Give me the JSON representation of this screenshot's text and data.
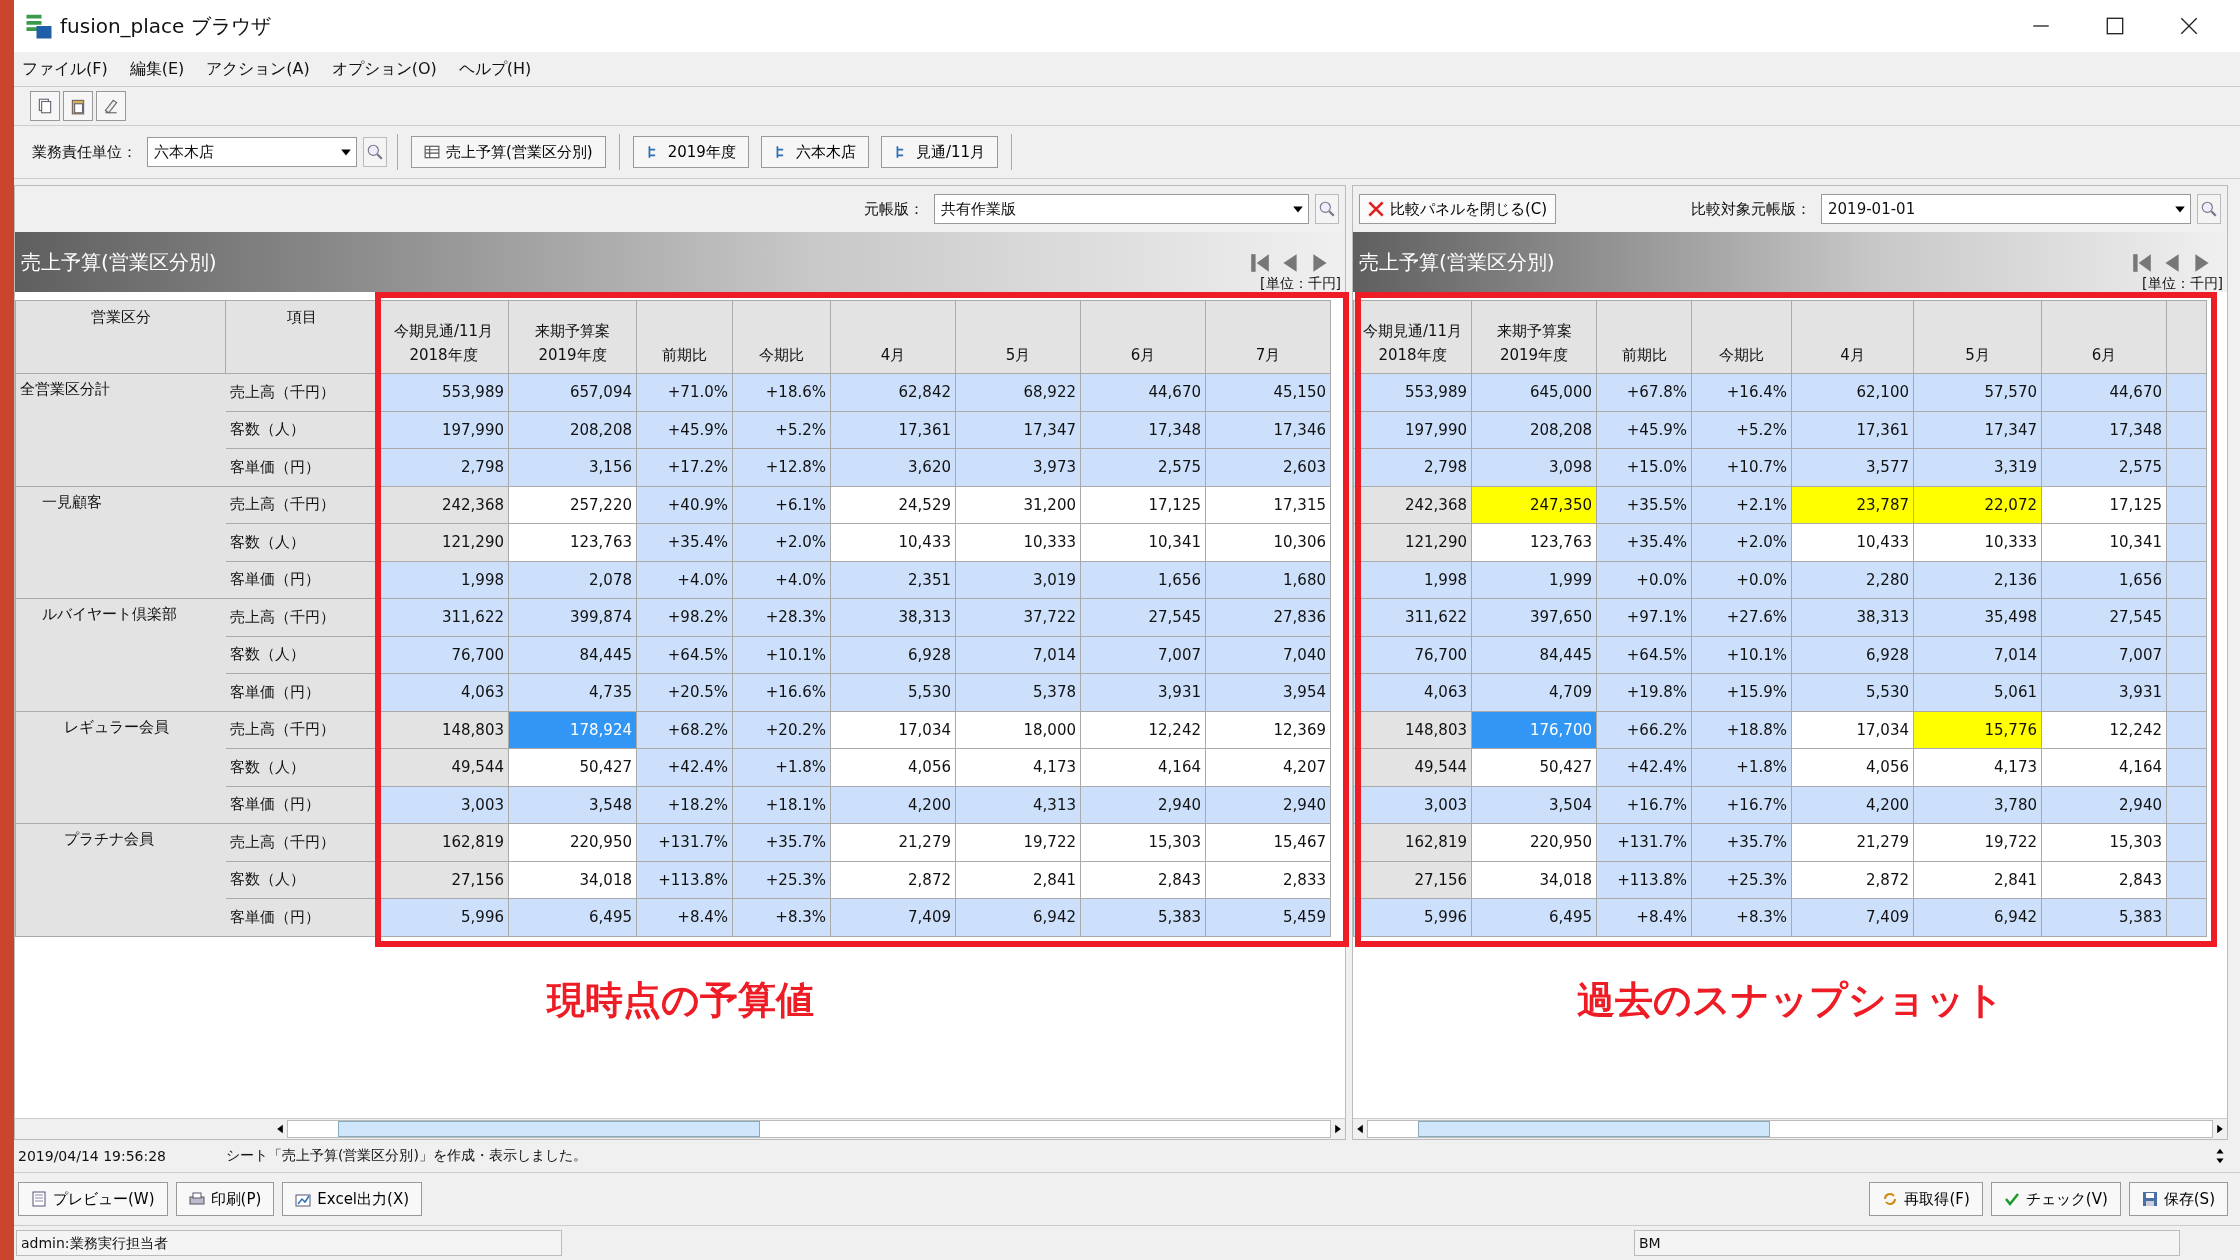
{
  "window": {
    "title": "fusion_place ブラウザ"
  },
  "menu": [
    "ファイル(F)",
    "編集(E)",
    "アクション(A)",
    "オプション(O)",
    "ヘルプ(H)"
  ],
  "toolbar": {
    "unit_label": "業務責任単位：",
    "unit_value": "六本木店",
    "chips": [
      {
        "label": "売上予算(営業区分別)",
        "kind": "sheet"
      },
      {
        "label": "2019年度",
        "kind": "dimension"
      },
      {
        "label": "六本木店",
        "kind": "dimension"
      },
      {
        "label": "見通/11月",
        "kind": "dimension"
      }
    ]
  },
  "left_panel": {
    "ledger_label": "元帳版：",
    "ledger_value": "共有作業版",
    "title": "売上予算(営業区分別)",
    "unit": "[単位：千円]",
    "annotation": "現時点の予算値",
    "header": [
      [
        "営業区分"
      ],
      [
        "項目"
      ]
    ],
    "columns": [
      [
        "今期見通/11月",
        "2018年度"
      ],
      [
        "来期予算案",
        "2019年度"
      ],
      [
        "前期比"
      ],
      [
        "今期比"
      ],
      [
        "4月"
      ],
      [
        "5月"
      ],
      [
        "6月"
      ],
      [
        "7月"
      ]
    ]
  },
  "right_panel": {
    "close_button": "比較パネルを閉じる(C)",
    "ledger_label": "比較対象元帳版：",
    "ledger_value": "2019-01-01",
    "title": "売上予算(営業区分別)",
    "unit": "[単位：千円]",
    "annotation": "過去のスナップショット",
    "columns": [
      [
        "今期見通/11月",
        "2018年度"
      ],
      [
        "来期予算案",
        "2019年度"
      ],
      [
        "前期比"
      ],
      [
        "今期比"
      ],
      [
        "4月"
      ],
      [
        "5月"
      ],
      [
        "6月"
      ]
    ]
  },
  "tree": [
    {
      "name": "全営業区分計",
      "rows": [
        {
          "item": "売上高（千円）",
          "cells": [
            {
              "text": "553,989",
              "kind": "calc"
            },
            {
              "text": "657,094",
              "kind": "calc"
            },
            {
              "text": "+71.0%",
              "kind": "calc"
            },
            {
              "text": "+18.6%",
              "kind": "calc"
            },
            {
              "text": "62,842",
              "kind": "calc"
            },
            {
              "text": "68,922",
              "kind": "calc"
            },
            {
              "text": "44,670",
              "kind": "calc"
            },
            {
              "text": "45,150",
              "kind": "calc"
            }
          ],
          "compare": [
            {
              "text": "553,989",
              "kind": "calc"
            },
            {
              "text": "645,000",
              "kind": "calc"
            },
            {
              "text": "+67.8%",
              "kind": "calc"
            },
            {
              "text": "+16.4%",
              "kind": "calc"
            },
            {
              "text": "62,100",
              "kind": "calc"
            },
            {
              "text": "57,570",
              "kind": "calc"
            },
            {
              "text": "44,670",
              "kind": "calc"
            }
          ]
        },
        {
          "item": "客数（人）",
          "cells": [
            {
              "text": "197,990",
              "kind": "calc"
            },
            {
              "text": "208,208",
              "kind": "calc"
            },
            {
              "text": "+45.9%",
              "kind": "calc"
            },
            {
              "text": "+5.2%",
              "kind": "calc"
            },
            {
              "text": "17,361",
              "kind": "calc"
            },
            {
              "text": "17,347",
              "kind": "calc"
            },
            {
              "text": "17,348",
              "kind": "calc"
            },
            {
              "text": "17,346",
              "kind": "calc"
            }
          ],
          "compare": [
            {
              "text": "197,990",
              "kind": "calc"
            },
            {
              "text": "208,208",
              "kind": "calc"
            },
            {
              "text": "+45.9%",
              "kind": "calc"
            },
            {
              "text": "+5.2%",
              "kind": "calc"
            },
            {
              "text": "17,361",
              "kind": "calc"
            },
            {
              "text": "17,347",
              "kind": "calc"
            },
            {
              "text": "17,348",
              "kind": "calc"
            }
          ]
        },
        {
          "item": "客単価（円）",
          "cells": [
            {
              "text": "2,798",
              "kind": "calc"
            },
            {
              "text": "3,156",
              "kind": "calc"
            },
            {
              "text": "+17.2%",
              "kind": "calc"
            },
            {
              "text": "+12.8%",
              "kind": "calc"
            },
            {
              "text": "3,620",
              "kind": "calc"
            },
            {
              "text": "3,973",
              "kind": "calc"
            },
            {
              "text": "2,575",
              "kind": "calc"
            },
            {
              "text": "2,603",
              "kind": "calc"
            }
          ],
          "compare": [
            {
              "text": "2,798",
              "kind": "calc"
            },
            {
              "text": "3,098",
              "kind": "calc"
            },
            {
              "text": "+15.0%",
              "kind": "calc"
            },
            {
              "text": "+10.7%",
              "kind": "calc"
            },
            {
              "text": "3,577",
              "kind": "calc"
            },
            {
              "text": "3,319",
              "kind": "calc"
            },
            {
              "text": "2,575",
              "kind": "calc"
            }
          ]
        }
      ],
      "children": [
        {
          "name": "一見顧客",
          "rows": [
            {
              "item": "売上高（千円）",
              "cells": [
                {
                  "text": "242,368",
                  "kind": "base"
                },
                {
                  "text": "257,220",
                  "kind": "input"
                },
                {
                  "text": "+40.9%",
                  "kind": "calc"
                },
                {
                  "text": "+6.1%",
                  "kind": "calc"
                },
                {
                  "text": "24,529",
                  "kind": "input"
                },
                {
                  "text": "31,200",
                  "kind": "input"
                },
                {
                  "text": "17,125",
                  "kind": "input"
                },
                {
                  "text": "17,315",
                  "kind": "input"
                }
              ],
              "compare": [
                {
                  "text": "242,368",
                  "kind": "base"
                },
                {
                  "text": "247,350",
                  "kind": "changed"
                },
                {
                  "text": "+35.5%",
                  "kind": "calc"
                },
                {
                  "text": "+2.1%",
                  "kind": "calc"
                },
                {
                  "text": "23,787",
                  "kind": "changed"
                },
                {
                  "text": "22,072",
                  "kind": "changed"
                },
                {
                  "text": "17,125",
                  "kind": "input"
                }
              ]
            },
            {
              "item": "客数（人）",
              "cells": [
                {
                  "text": "121,290",
                  "kind": "base"
                },
                {
                  "text": "123,763",
                  "kind": "input"
                },
                {
                  "text": "+35.4%",
                  "kind": "calc"
                },
                {
                  "text": "+2.0%",
                  "kind": "calc"
                },
                {
                  "text": "10,433",
                  "kind": "input"
                },
                {
                  "text": "10,333",
                  "kind": "input"
                },
                {
                  "text": "10,341",
                  "kind": "input"
                },
                {
                  "text": "10,306",
                  "kind": "input"
                }
              ],
              "compare": [
                {
                  "text": "121,290",
                  "kind": "base"
                },
                {
                  "text": "123,763",
                  "kind": "input"
                },
                {
                  "text": "+35.4%",
                  "kind": "calc"
                },
                {
                  "text": "+2.0%",
                  "kind": "calc"
                },
                {
                  "text": "10,433",
                  "kind": "input"
                },
                {
                  "text": "10,333",
                  "kind": "input"
                },
                {
                  "text": "10,341",
                  "kind": "input"
                }
              ]
            },
            {
              "item": "客単価（円）",
              "cells": [
                {
                  "text": "1,998",
                  "kind": "calc"
                },
                {
                  "text": "2,078",
                  "kind": "calc"
                },
                {
                  "text": "+4.0%",
                  "kind": "calc"
                },
                {
                  "text": "+4.0%",
                  "kind": "calc"
                },
                {
                  "text": "2,351",
                  "kind": "calc"
                },
                {
                  "text": "3,019",
                  "kind": "calc"
                },
                {
                  "text": "1,656",
                  "kind": "calc"
                },
                {
                  "text": "1,680",
                  "kind": "calc"
                }
              ],
              "compare": [
                {
                  "text": "1,998",
                  "kind": "calc"
                },
                {
                  "text": "1,999",
                  "kind": "calc"
                },
                {
                  "text": "+0.0%",
                  "kind": "calc"
                },
                {
                  "text": "+0.0%",
                  "kind": "calc"
                },
                {
                  "text": "2,280",
                  "kind": "calc"
                },
                {
                  "text": "2,136",
                  "kind": "calc"
                },
                {
                  "text": "1,656",
                  "kind": "calc"
                }
              ]
            }
          ]
        },
        {
          "name": "ルバイヤート倶楽部",
          "rows": [
            {
              "item": "売上高（千円）",
              "cells": [
                {
                  "text": "311,622",
                  "kind": "calc"
                },
                {
                  "text": "399,874",
                  "kind": "calc"
                },
                {
                  "text": "+98.2%",
                  "kind": "calc"
                },
                {
                  "text": "+28.3%",
                  "kind": "calc"
                },
                {
                  "text": "38,313",
                  "kind": "calc"
                },
                {
                  "text": "37,722",
                  "kind": "calc"
                },
                {
                  "text": "27,545",
                  "kind": "calc"
                },
                {
                  "text": "27,836",
                  "kind": "calc"
                }
              ],
              "compare": [
                {
                  "text": "311,622",
                  "kind": "calc"
                },
                {
                  "text": "397,650",
                  "kind": "calc"
                },
                {
                  "text": "+97.1%",
                  "kind": "calc"
                },
                {
                  "text": "+27.6%",
                  "kind": "calc"
                },
                {
                  "text": "38,313",
                  "kind": "calc"
                },
                {
                  "text": "35,498",
                  "kind": "calc"
                },
                {
                  "text": "27,545",
                  "kind": "calc"
                }
              ]
            },
            {
              "item": "客数（人）",
              "cells": [
                {
                  "text": "76,700",
                  "kind": "calc"
                },
                {
                  "text": "84,445",
                  "kind": "calc"
                },
                {
                  "text": "+64.5%",
                  "kind": "calc"
                },
                {
                  "text": "+10.1%",
                  "kind": "calc"
                },
                {
                  "text": "6,928",
                  "kind": "calc"
                },
                {
                  "text": "7,014",
                  "kind": "calc"
                },
                {
                  "text": "7,007",
                  "kind": "calc"
                },
                {
                  "text": "7,040",
                  "kind": "calc"
                }
              ],
              "compare": [
                {
                  "text": "76,700",
                  "kind": "calc"
                },
                {
                  "text": "84,445",
                  "kind": "calc"
                },
                {
                  "text": "+64.5%",
                  "kind": "calc"
                },
                {
                  "text": "+10.1%",
                  "kind": "calc"
                },
                {
                  "text": "6,928",
                  "kind": "calc"
                },
                {
                  "text": "7,014",
                  "kind": "calc"
                },
                {
                  "text": "7,007",
                  "kind": "calc"
                }
              ]
            },
            {
              "item": "客単価（円）",
              "cells": [
                {
                  "text": "4,063",
                  "kind": "calc"
                },
                {
                  "text": "4,735",
                  "kind": "calc"
                },
                {
                  "text": "+20.5%",
                  "kind": "calc"
                },
                {
                  "text": "+16.6%",
                  "kind": "calc"
                },
                {
                  "text": "5,530",
                  "kind": "calc"
                },
                {
                  "text": "5,378",
                  "kind": "calc"
                },
                {
                  "text": "3,931",
                  "kind": "calc"
                },
                {
                  "text": "3,954",
                  "kind": "calc"
                }
              ],
              "compare": [
                {
                  "text": "4,063",
                  "kind": "calc"
                },
                {
                  "text": "4,709",
                  "kind": "calc"
                },
                {
                  "text": "+19.8%",
                  "kind": "calc"
                },
                {
                  "text": "+15.9%",
                  "kind": "calc"
                },
                {
                  "text": "5,530",
                  "kind": "calc"
                },
                {
                  "text": "5,061",
                  "kind": "calc"
                },
                {
                  "text": "3,931",
                  "kind": "calc"
                }
              ]
            }
          ],
          "children": [
            {
              "name": "レギュラー会員",
              "rows": [
                {
                  "item": "売上高（千円）",
                  "cells": [
                    {
                      "text": "148,803",
                      "kind": "base"
                    },
                    {
                      "text": "178,924",
                      "kind": "selected"
                    },
                    {
                      "text": "+68.2%",
                      "kind": "calc"
                    },
                    {
                      "text": "+20.2%",
                      "kind": "calc"
                    },
                    {
                      "text": "17,034",
                      "kind": "input"
                    },
                    {
                      "text": "18,000",
                      "kind": "input"
                    },
                    {
                      "text": "12,242",
                      "kind": "input"
                    },
                    {
                      "text": "12,369",
                      "kind": "input"
                    }
                  ],
                  "compare": [
                    {
                      "text": "148,803",
                      "kind": "base"
                    },
                    {
                      "text": "176,700",
                      "kind": "selected"
                    },
                    {
                      "text": "+66.2%",
                      "kind": "calc"
                    },
                    {
                      "text": "+18.8%",
                      "kind": "calc"
                    },
                    {
                      "text": "17,034",
                      "kind": "input"
                    },
                    {
                      "text": "15,776",
                      "kind": "changed"
                    },
                    {
                      "text": "12,242",
                      "kind": "input"
                    }
                  ]
                },
                {
                  "item": "客数（人）",
                  "cells": [
                    {
                      "text": "49,544",
                      "kind": "base"
                    },
                    {
                      "text": "50,427",
                      "kind": "input"
                    },
                    {
                      "text": "+42.4%",
                      "kind": "calc"
                    },
                    {
                      "text": "+1.8%",
                      "kind": "calc"
                    },
                    {
                      "text": "4,056",
                      "kind": "input"
                    },
                    {
                      "text": "4,173",
                      "kind": "input"
                    },
                    {
                      "text": "4,164",
                      "kind": "input"
                    },
                    {
                      "text": "4,207",
                      "kind": "input"
                    }
                  ],
                  "compare": [
                    {
                      "text": "49,544",
                      "kind": "base"
                    },
                    {
                      "text": "50,427",
                      "kind": "input"
                    },
                    {
                      "text": "+42.4%",
                      "kind": "calc"
                    },
                    {
                      "text": "+1.8%",
                      "kind": "calc"
                    },
                    {
                      "text": "4,056",
                      "kind": "input"
                    },
                    {
                      "text": "4,173",
                      "kind": "input"
                    },
                    {
                      "text": "4,164",
                      "kind": "input"
                    }
                  ]
                },
                {
                  "item": "客単価（円）",
                  "cells": [
                    {
                      "text": "3,003",
                      "kind": "calc"
                    },
                    {
                      "text": "3,548",
                      "kind": "calc"
                    },
                    {
                      "text": "+18.2%",
                      "kind": "calc"
                    },
                    {
                      "text": "+18.1%",
                      "kind": "calc"
                    },
                    {
                      "text": "4,200",
                      "kind": "calc"
                    },
                    {
                      "text": "4,313",
                      "kind": "calc"
                    },
                    {
                      "text": "2,940",
                      "kind": "calc"
                    },
                    {
                      "text": "2,940",
                      "kind": "calc"
                    }
                  ],
                  "compare": [
                    {
                      "text": "3,003",
                      "kind": "calc"
                    },
                    {
                      "text": "3,504",
                      "kind": "calc"
                    },
                    {
                      "text": "+16.7%",
                      "kind": "calc"
                    },
                    {
                      "text": "+16.7%",
                      "kind": "calc"
                    },
                    {
                      "text": "4,200",
                      "kind": "calc"
                    },
                    {
                      "text": "3,780",
                      "kind": "calc"
                    },
                    {
                      "text": "2,940",
                      "kind": "calc"
                    }
                  ]
                }
              ]
            },
            {
              "name": "プラチナ会員",
              "rows": [
                {
                  "item": "売上高（千円）",
                  "cells": [
                    {
                      "text": "162,819",
                      "kind": "base"
                    },
                    {
                      "text": "220,950",
                      "kind": "input"
                    },
                    {
                      "text": "+131.7%",
                      "kind": "calc"
                    },
                    {
                      "text": "+35.7%",
                      "kind": "calc"
                    },
                    {
                      "text": "21,279",
                      "kind": "input"
                    },
                    {
                      "text": "19,722",
                      "kind": "input"
                    },
                    {
                      "text": "15,303",
                      "kind": "input"
                    },
                    {
                      "text": "15,467",
                      "kind": "input"
                    }
                  ],
                  "compare": [
                    {
                      "text": "162,819",
                      "kind": "base"
                    },
                    {
                      "text": "220,950",
                      "kind": "input"
                    },
                    {
                      "text": "+131.7%",
                      "kind": "calc"
                    },
                    {
                      "text": "+35.7%",
                      "kind": "calc"
                    },
                    {
                      "text": "21,279",
                      "kind": "input"
                    },
                    {
                      "text": "19,722",
                      "kind": "input"
                    },
                    {
                      "text": "15,303",
                      "kind": "input"
                    }
                  ]
                },
                {
                  "item": "客数（人）",
                  "cells": [
                    {
                      "text": "27,156",
                      "kind": "base"
                    },
                    {
                      "text": "34,018",
                      "kind": "input"
                    },
                    {
                      "text": "+113.8%",
                      "kind": "calc"
                    },
                    {
                      "text": "+25.3%",
                      "kind": "calc"
                    },
                    {
                      "text": "2,872",
                      "kind": "input"
                    },
                    {
                      "text": "2,841",
                      "kind": "input"
                    },
                    {
                      "text": "2,843",
                      "kind": "input"
                    },
                    {
                      "text": "2,833",
                      "kind": "input"
                    }
                  ],
                  "compare": [
                    {
                      "text": "27,156",
                      "kind": "base"
                    },
                    {
                      "text": "34,018",
                      "kind": "input"
                    },
                    {
                      "text": "+113.8%",
                      "kind": "calc"
                    },
                    {
                      "text": "+25.3%",
                      "kind": "calc"
                    },
                    {
                      "text": "2,872",
                      "kind": "input"
                    },
                    {
                      "text": "2,841",
                      "kind": "input"
                    },
                    {
                      "text": "2,843",
                      "kind": "input"
                    }
                  ]
                },
                {
                  "item": "客単価（円）",
                  "cells": [
                    {
                      "text": "5,996",
                      "kind": "calc"
                    },
                    {
                      "text": "6,495",
                      "kind": "calc"
                    },
                    {
                      "text": "+8.4%",
                      "kind": "calc"
                    },
                    {
                      "text": "+8.3%",
                      "kind": "calc"
                    },
                    {
                      "text": "7,409",
                      "kind": "calc"
                    },
                    {
                      "text": "6,942",
                      "kind": "calc"
                    },
                    {
                      "text": "5,383",
                      "kind": "calc"
                    },
                    {
                      "text": "5,459",
                      "kind": "calc"
                    }
                  ],
                  "compare": [
                    {
                      "text": "5,996",
                      "kind": "calc"
                    },
                    {
                      "text": "6,495",
                      "kind": "calc"
                    },
                    {
                      "text": "+8.4%",
                      "kind": "calc"
                    },
                    {
                      "text": "+8.3%",
                      "kind": "calc"
                    },
                    {
                      "text": "7,409",
                      "kind": "calc"
                    },
                    {
                      "text": "6,942",
                      "kind": "calc"
                    },
                    {
                      "text": "5,383",
                      "kind": "calc"
                    }
                  ]
                }
              ]
            }
          ]
        }
      ]
    }
  ],
  "message": {
    "time": "2019/04/14 19:56:28",
    "text": "シート「売上予算(営業区分別)」を作成・表示しました。"
  },
  "buttons_left": [
    {
      "label": "プレビュー(W)",
      "kind": "preview"
    },
    {
      "label": "印刷(P)",
      "kind": "print"
    },
    {
      "label": "Excel出力(X)",
      "kind": "excel"
    }
  ],
  "buttons_right": [
    {
      "label": "再取得(F)",
      "kind": "reload"
    },
    {
      "label": "チェック(V)",
      "kind": "check"
    },
    {
      "label": "保存(S)",
      "kind": "save"
    }
  ],
  "status": {
    "user": "admin:業務実行担当者",
    "code": "BM"
  }
}
